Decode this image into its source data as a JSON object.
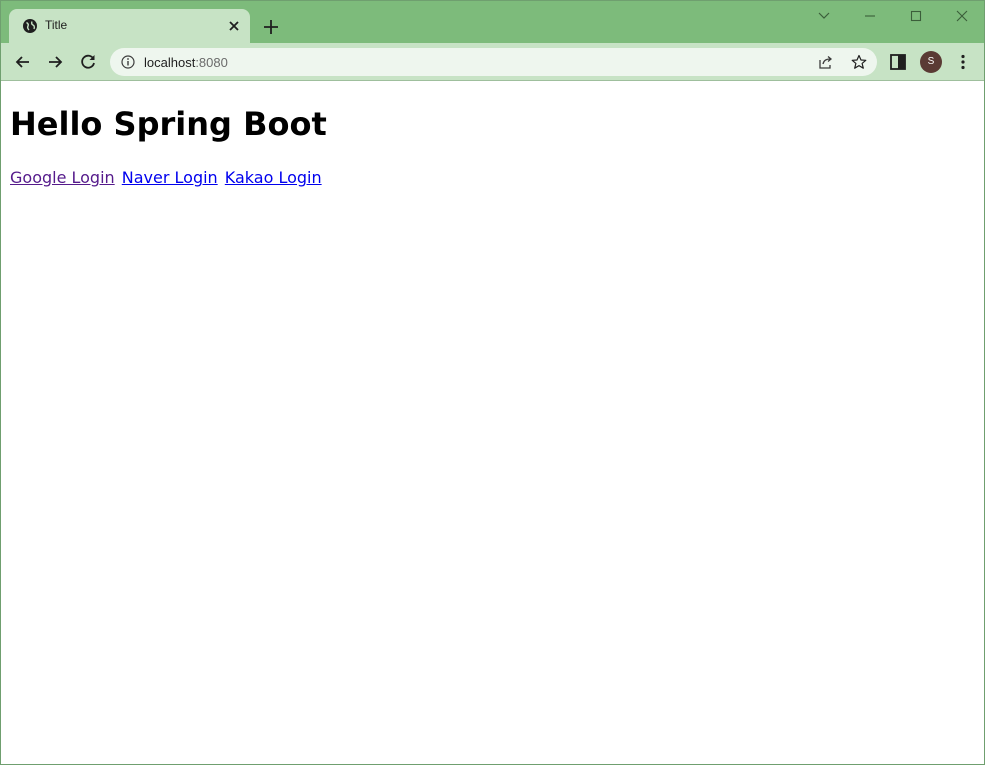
{
  "browser": {
    "tab": {
      "title": "Title"
    },
    "address_bar": {
      "host": "localhost",
      "port": ":8080"
    },
    "profile": {
      "initial": "S"
    }
  },
  "page": {
    "heading": "Hello Spring Boot",
    "links": [
      {
        "label": "Google Login",
        "state": "visited"
      },
      {
        "label": "Naver Login",
        "state": "unvisited"
      },
      {
        "label": "Kakao Login",
        "state": "unvisited"
      }
    ]
  },
  "colors": {
    "frame": "#7dbb7b",
    "toolbar": "#c7e3c5",
    "omnibox": "#eef6ee",
    "visited_link": "#551a8b",
    "link": "#0000ee",
    "avatar": "#5a3a34"
  },
  "icons": {
    "favicon": "globe-icon",
    "tab_close": "close-icon",
    "new_tab": "plus-icon",
    "back": "back-arrow-icon",
    "forward": "forward-arrow-icon",
    "reload": "reload-icon",
    "site_info": "info-icon",
    "share": "share-icon",
    "bookmark": "star-icon",
    "side_panel": "side-panel-icon",
    "menu": "kebab-menu-icon",
    "tab_search": "chevron-down-icon",
    "minimize": "minimize-icon",
    "maximize": "maximize-icon",
    "close_window": "close-window-icon"
  }
}
